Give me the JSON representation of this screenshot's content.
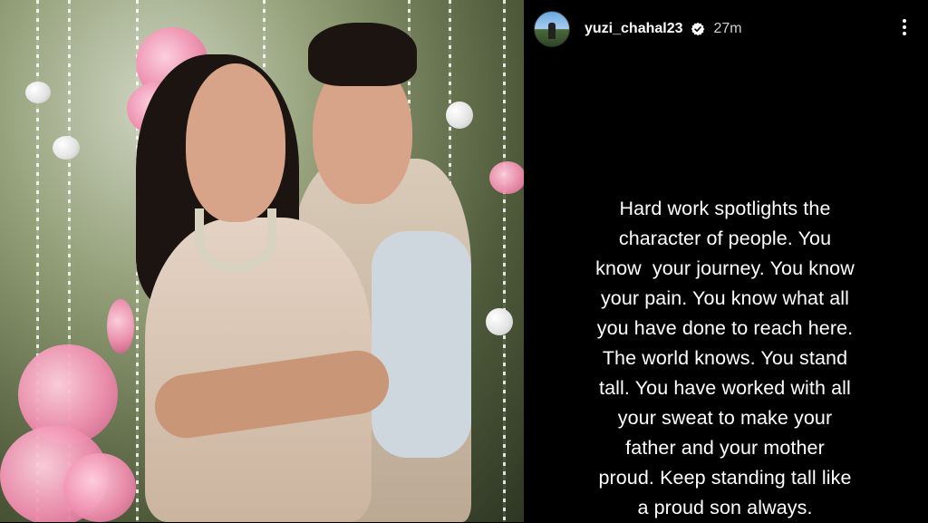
{
  "post_image": {
    "description_icon": "couple-photo"
  },
  "story": {
    "username": "yuzi_chahal23",
    "verified_icon": "verified-badge-icon",
    "time_ago": "27m",
    "more_icon": "more-options-icon",
    "caption_lines": [
      "Hard work spotlights the",
      "character of people. You",
      "know  your journey. You know",
      "your pain. You know what all",
      "you have done to reach here.",
      "The world knows. You stand",
      "tall. You have worked with all",
      "your sweat to make your",
      "father and your mother",
      "proud. Keep standing tall like",
      "a proud son always."
    ]
  },
  "colors": {
    "background": "#000000",
    "text": "#ffffff",
    "time": "#d0d0d0"
  }
}
